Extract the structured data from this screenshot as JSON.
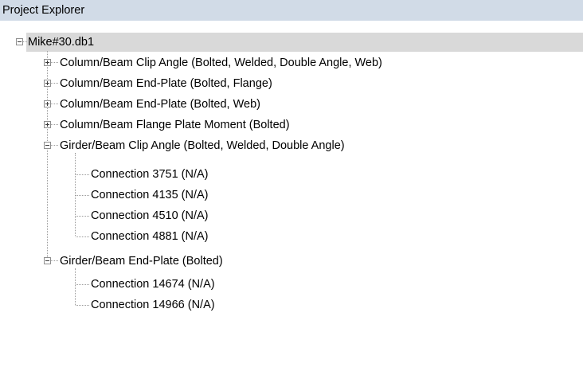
{
  "panel": {
    "title": "Project Explorer"
  },
  "tree": {
    "root": {
      "label": "Mike#30.db1",
      "expanded": true
    },
    "categories": [
      {
        "label": "Column/Beam Clip Angle (Bolted, Welded, Double Angle, Web)",
        "expanded": false,
        "connections": []
      },
      {
        "label": "Column/Beam End-Plate (Bolted, Flange)",
        "expanded": false,
        "connections": []
      },
      {
        "label": "Column/Beam End-Plate (Bolted, Web)",
        "expanded": false,
        "connections": []
      },
      {
        "label": "Column/Beam Flange Plate Moment (Bolted)",
        "expanded": false,
        "connections": []
      },
      {
        "label": "Girder/Beam Clip Angle (Bolted, Welded, Double Angle)",
        "expanded": true,
        "connections": [
          "Connection 3751  (N/A)",
          "Connection 4135  (N/A)",
          "Connection 4510  (N/A)",
          "Connection 4881  (N/A)"
        ]
      },
      {
        "label": "Girder/Beam End-Plate (Bolted)",
        "expanded": true,
        "connections": [
          "Connection 14674  (N/A)",
          "Connection 14966  (N/A)"
        ]
      }
    ]
  },
  "colors": {
    "header_bg": "#d1dbe7",
    "selected_bg": "#d9d9d9",
    "tree_line": "#9a9a9a"
  }
}
